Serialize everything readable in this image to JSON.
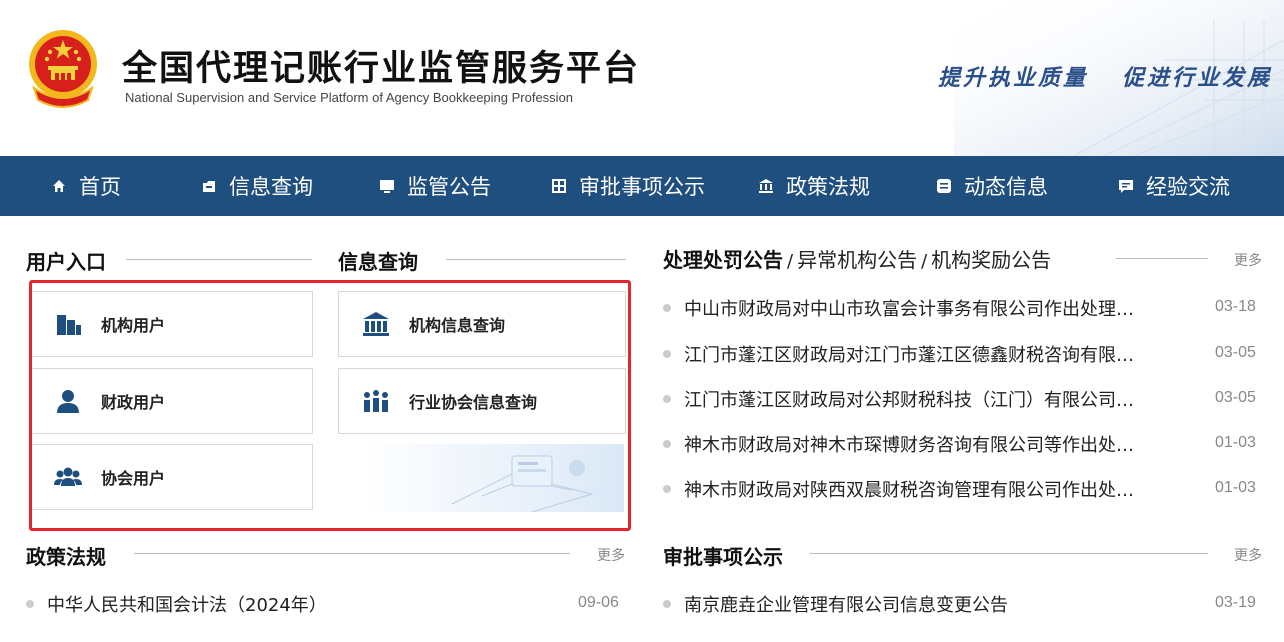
{
  "header": {
    "title": "全国代理记账行业监管服务平台",
    "subtitle": "National Supervision and Service Platform of Agency Bookkeeping  Profession",
    "slogan_1": "提升执业质量",
    "slogan_2": "促进行业发展"
  },
  "nav": {
    "items": [
      {
        "label": "首页",
        "icon": "home-icon"
      },
      {
        "label": "信息查询",
        "icon": "folder-icon"
      },
      {
        "label": "监管公告",
        "icon": "monitor-icon"
      },
      {
        "label": "审批事项公示",
        "icon": "grid-doc-icon"
      },
      {
        "label": "政策法规",
        "icon": "bank-icon"
      },
      {
        "label": "动态信息",
        "icon": "doc-icon"
      },
      {
        "label": "经验交流",
        "icon": "chat-icon"
      }
    ]
  },
  "user_entry": {
    "title": "用户入口",
    "items": [
      {
        "label": "机构用户",
        "icon": "building-icon"
      },
      {
        "label": "财政用户",
        "icon": "person-icon"
      },
      {
        "label": "协会用户",
        "icon": "group-icon"
      }
    ]
  },
  "info_query": {
    "title": "信息查询",
    "items": [
      {
        "label": "机构信息查询",
        "icon": "bank-icon"
      },
      {
        "label": "行业协会信息查询",
        "icon": "people-chart-icon"
      }
    ]
  },
  "announcements": {
    "tabs": [
      {
        "label": "处理处罚公告"
      },
      {
        "label": "异常机构公告"
      },
      {
        "label": "机构奖励公告"
      }
    ],
    "separator": "/",
    "more": "更多",
    "items": [
      {
        "text": "中山市财政局对中山市玖富会计事务有限公司作出处理…",
        "date": "03-18"
      },
      {
        "text": "江门市蓬江区财政局对江门市蓬江区德鑫财税咨询有限…",
        "date": "03-05"
      },
      {
        "text": "江门市蓬江区财政局对公邦财税科技（江门）有限公司…",
        "date": "03-05"
      },
      {
        "text": "神木市财政局对神木市琛博财务咨询有限公司等作出处…",
        "date": "01-03"
      },
      {
        "text": "神木市财政局对陕西双晨财税咨询管理有限公司作出处…",
        "date": "01-03"
      }
    ]
  },
  "policy": {
    "title": "政策法规",
    "more": "更多",
    "items": [
      {
        "text": "中华人民共和国会计法（2024年）",
        "date": "09-06"
      }
    ]
  },
  "approval": {
    "title": "审批事项公示",
    "more": "更多",
    "items": [
      {
        "text": "南京鹿垚企业管理有限公司信息变更公告",
        "date": "03-19"
      }
    ]
  },
  "colors": {
    "nav_bg": "#1f4f7f",
    "highlight_border": "#e3262b",
    "icon_blue": "#1f4f7f",
    "slogan": "#2b4f8a"
  }
}
